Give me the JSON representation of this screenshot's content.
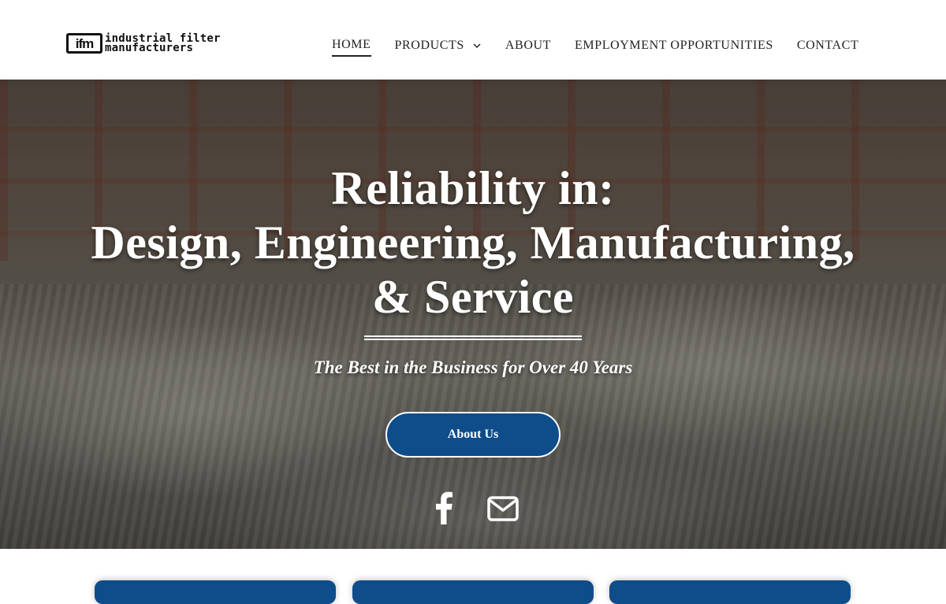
{
  "brand": {
    "logo_mark": "ifm",
    "line1": "industrial filter",
    "line2": "manufacturers"
  },
  "nav": {
    "items": [
      {
        "label": "HOME",
        "active": true
      },
      {
        "label": "PRODUCTS",
        "has_dropdown": true
      },
      {
        "label": "ABOUT"
      },
      {
        "label": "EMPLOYMENT OPPORTUNITIES"
      },
      {
        "label": "CONTACT"
      }
    ]
  },
  "hero": {
    "headline_line1": "Reliability in:",
    "headline_line2": "Design, Engineering, Manufacturing,",
    "headline_line3": "& Service",
    "tagline": "The Best in the Business for Over 40 Years",
    "cta_label": "About Us",
    "social_icons": [
      "facebook-icon",
      "mail-icon"
    ]
  },
  "colors": {
    "accent": "#0e4c8a",
    "header_bg": "#ffffff",
    "text_dark": "#222222",
    "hero_text": "#ffffff"
  }
}
